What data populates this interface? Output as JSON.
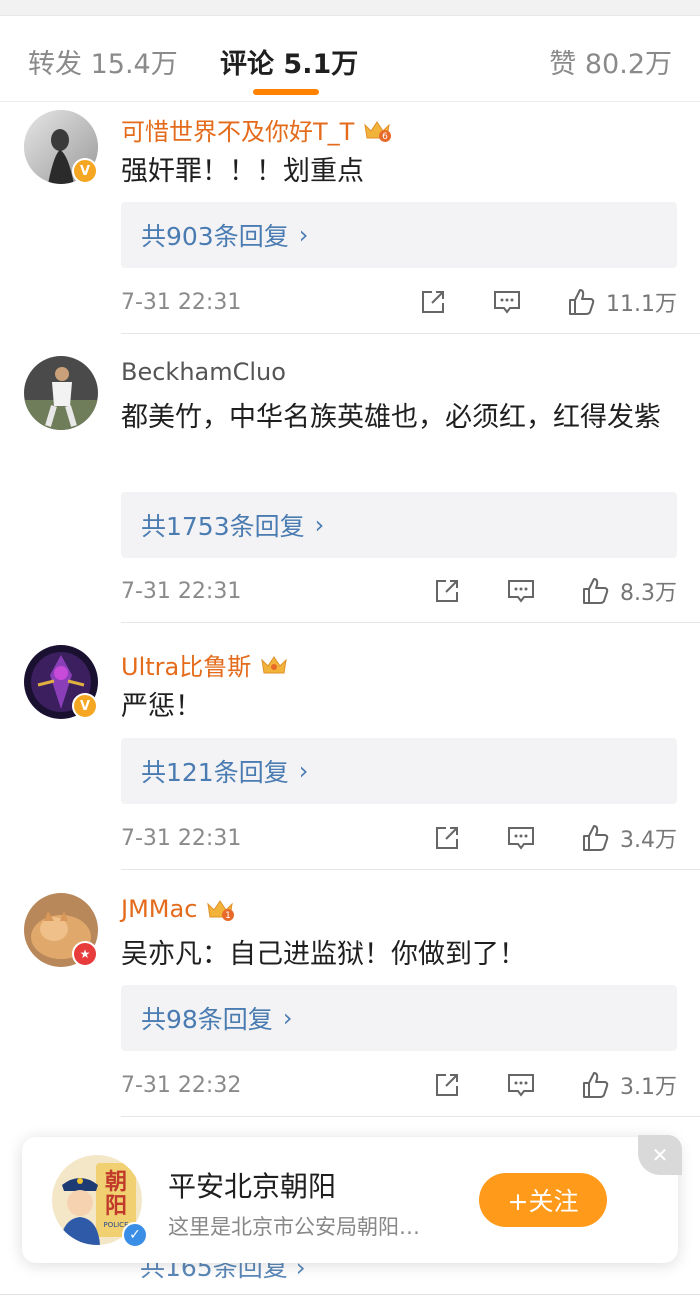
{
  "tabs": [
    {
      "label": "转发",
      "count": "15.4万"
    },
    {
      "label": "评论",
      "count": "5.1万"
    },
    {
      "label": "赞",
      "count": "80.2万"
    }
  ],
  "comments": [
    {
      "username": "可惜世界不及你好T_T",
      "text": "强奸罪！！！划重点",
      "replies": "共903条回复",
      "time": "7-31 22:31",
      "likes": "11.1万",
      "vip_level": "6",
      "badge": "V"
    },
    {
      "username": "BeckhamCluo",
      "text": "都美竹，中华名族英雄也，必须红，红得发紫",
      "replies": "共1753条回复",
      "time": "7-31 22:31",
      "likes": "8.3万"
    },
    {
      "username": "Ultra比鲁斯",
      "text": "严惩！",
      "replies": "共121条回复",
      "time": "7-31 22:31",
      "likes": "3.4万",
      "badge": "V"
    },
    {
      "username": "JMMac",
      "text": "吴亦凡：自己进监狱！你做到了！",
      "replies": "共98条回复",
      "time": "7-31 22:32",
      "likes": "3.1万",
      "vip_level": "1",
      "badge": "★"
    }
  ],
  "follow_card": {
    "name": "平安北京朝阳",
    "desc": "这里是北京市公安局朝阳…",
    "button": "+关注",
    "close": "✕",
    "avatar_text_1": "朝",
    "avatar_text_2": "阳",
    "avatar_text_3": "POLICE",
    "verified": "✓"
  },
  "peek_replies": "共165条回复 ›",
  "colors": {
    "accent": "#ff8200",
    "link": "#4a7cb2",
    "vip_name": "#e36b1b",
    "follow": "#ff9a1a"
  }
}
